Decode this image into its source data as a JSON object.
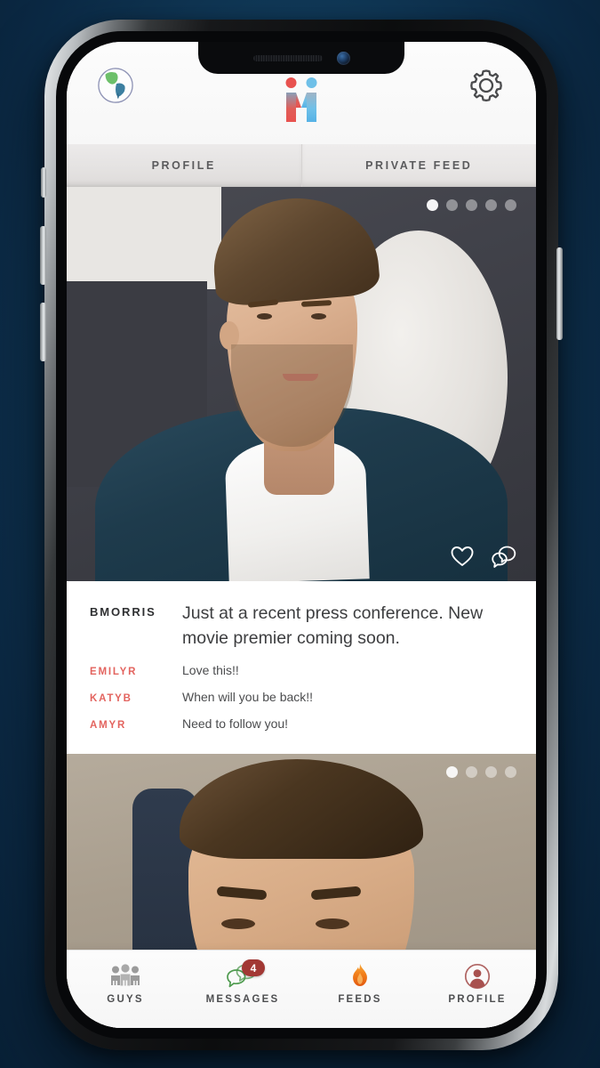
{
  "app": {
    "logo_name": "mi-logo",
    "logo_colors": {
      "left": "#e8524f",
      "right": "#5fb6e8"
    }
  },
  "header": {
    "globe_icon": "globe-icon",
    "settings_icon": "gear-icon"
  },
  "tabs": [
    {
      "label": "PROFILE",
      "active": false
    },
    {
      "label": "PRIVATE FEED",
      "active": true
    }
  ],
  "posts": [
    {
      "dots_total": 5,
      "dots_active_index": 0,
      "actions": [
        {
          "icon": "heart-icon",
          "label": "Like"
        },
        {
          "icon": "comment-bubbles-icon",
          "label": "Comment"
        }
      ],
      "author": "BMORRIS",
      "caption": "Just at a recent press conference. New movie premier coming soon.",
      "comments": [
        {
          "user": "EMILYR",
          "text": "Love this!!"
        },
        {
          "user": "KATYB",
          "text": "When will you be back!!"
        },
        {
          "user": "AMYR",
          "text": "Need to follow you!"
        }
      ]
    },
    {
      "dots_total": 4,
      "dots_active_index": 0
    }
  ],
  "bottom_nav": [
    {
      "label": "GUYS",
      "icon": "people-group-icon",
      "badge": null
    },
    {
      "label": "MESSAGES",
      "icon": "chat-bubbles-icon",
      "badge": "4"
    },
    {
      "label": "FEEDS",
      "icon": "flame-icon",
      "badge": null
    },
    {
      "label": "PROFILE",
      "icon": "user-circle-icon",
      "badge": null
    }
  ],
  "colors": {
    "accent_red": "#e3645f",
    "badge_red": "#a23834",
    "flame_orange": "#f07a1a",
    "messages_green": "#5ea05e",
    "profile_maroon": "#a8514f"
  }
}
